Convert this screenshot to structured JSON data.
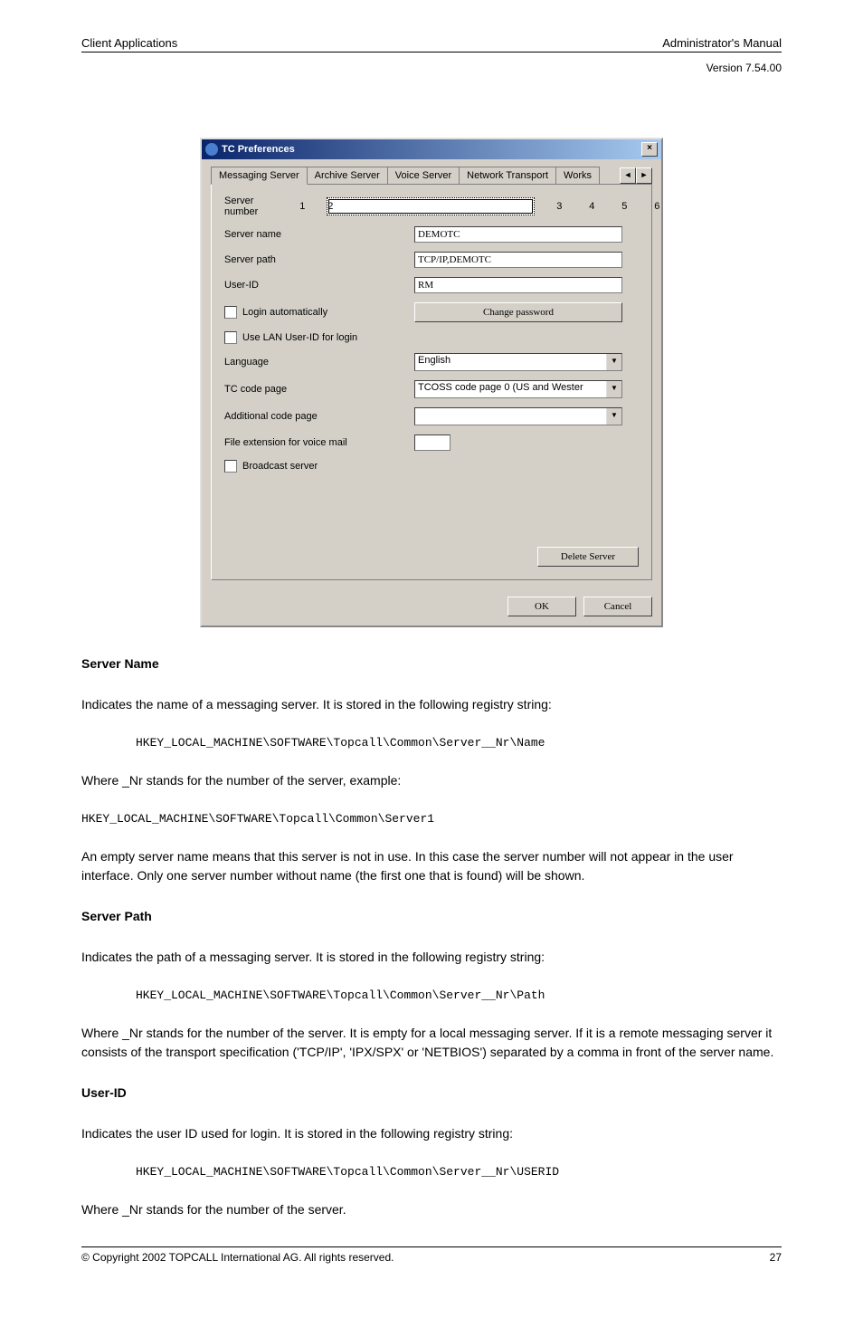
{
  "header": {
    "left": "Client Applications",
    "right": "Administrator's Manual",
    "version": "Version 7.54.00"
  },
  "dialog": {
    "title": "TC Preferences",
    "tabs": [
      "Messaging Server",
      "Archive Server",
      "Voice Server",
      "Network Transport",
      "Works"
    ],
    "active_tab": 0,
    "rows": {
      "server_number_lbl": "Server number",
      "server_numbers": [
        "1",
        "2",
        "3",
        "4",
        "5",
        "6"
      ],
      "server_name_lbl": "Server name",
      "server_name_val": "DEMOTC",
      "server_path_lbl": "Server path",
      "server_path_val": "TCP/IP,DEMOTC",
      "user_id_lbl": "User-ID",
      "user_id_val": "RM",
      "login_auto_lbl": "Login automatically",
      "change_pwd_btn": "Change password",
      "use_lan_lbl": "Use LAN User-ID for login",
      "language_lbl": "Language",
      "language_val": "English",
      "tc_codepage_lbl": "TC code page",
      "tc_codepage_val": "TCOSS code page 0 (US and Wester",
      "add_codepage_lbl": "Additional code page",
      "add_codepage_val": "",
      "file_ext_lbl": "File extension for voice mail",
      "file_ext_val": "",
      "broadcast_lbl": "Broadcast server",
      "delete_btn": "Delete Server"
    },
    "footer": {
      "ok": "OK",
      "cancel": "Cancel"
    }
  },
  "doc": {
    "sn_h": "Server Name",
    "sn_p1": "Indicates the name of a messaging server. It is stored in the following registry string:",
    "sn_reg": "HKEY_LOCAL_MACHINE\\SOFTWARE\\Topcall\\Common\\Server__Nr\\Name",
    "sn_p2": "Where  _Nr  stands for the number of the server, example:",
    "sn_reg2": "HKEY_LOCAL_MACHINE\\SOFTWARE\\Topcall\\Common\\Server1",
    "sn_p3": "An empty server name means that this server is not in use. In this case the server number will not appear in the user interface. Only one server number without name (the first one that is found) will be shown.",
    "sp_h": "Server Path",
    "sp_p1": "Indicates the path of a messaging server. It is stored in the following registry string:",
    "sp_reg": "HKEY_LOCAL_MACHINE\\SOFTWARE\\Topcall\\Common\\Server__Nr\\Path",
    "sp_p2": "Where  _Nr  stands for the number of the server. It is empty for a local messaging server. If it is a remote messaging server it consists of the transport specification ('TCP/IP', 'IPX/SPX' or 'NETBIOS') separated by a comma in front of the server name.",
    "ui_h": "User-ID",
    "ui_p1": "Indicates the user ID used for login. It is stored in the following registry string:",
    "ui_reg": "HKEY_LOCAL_MACHINE\\SOFTWARE\\Topcall\\Common\\Server__Nr\\USERID",
    "ui_p2": "Where  _Nr  stands for the number of the server.",
    "footer": "© Copyright 2002 TOPCALL International AG. All rights reserved.",
    "page": "27"
  }
}
